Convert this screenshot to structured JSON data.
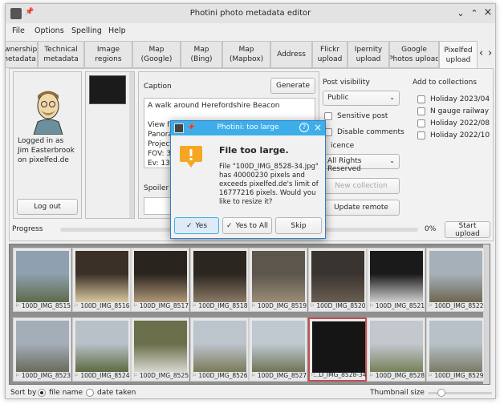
{
  "window": {
    "title": "Photini photo metadata editor",
    "controls": {
      "minimize": "⌄",
      "maximize": "⌃",
      "close": "×"
    }
  },
  "menu": [
    "File",
    "Options",
    "Spelling",
    "Help"
  ],
  "tabs": [
    {
      "label": "ownership\nmetadata"
    },
    {
      "label": "Technical\nmetadata"
    },
    {
      "label": "Image\nregions"
    },
    {
      "label": "Map\n(Google)"
    },
    {
      "label": "Map\n(Bing)"
    },
    {
      "label": "Map\n(Mapbox)"
    },
    {
      "label": "Address"
    },
    {
      "label": "Flickr\nupload"
    },
    {
      "label": "Ipernity\nupload"
    },
    {
      "label": "Google\nPhotos upload"
    },
    {
      "label": "Pixelfed\nupload"
    }
  ],
  "tab_nav": {
    "prev": "‹",
    "next": "›"
  },
  "account": {
    "logged_in_text": "Logged in as\nJim Easterbrook\non pixelfed.de",
    "logout_label": "Log out"
  },
  "caption": {
    "label": "Caption",
    "generate_label": "Generate",
    "text": "A walk around Herefordshire Beacon\n\nView from the top of the beacon hill.\nPanoram\nProjectio\nFOV: 36\nEv: 13.2"
  },
  "spoiler": {
    "label": "Spoiler"
  },
  "post_visibility": {
    "label": "Post visibility",
    "value": "Public",
    "sensitive_label": "Sensitive post",
    "disable_comments_label": "Disable comments",
    "licence_label": "icence",
    "licence_value": "All Rights Reserved",
    "new_collection_label": "New collection",
    "update_remote_label": "Update remote"
  },
  "collections": {
    "label": "Add to collections",
    "items": [
      "Holiday 2023/04",
      "N gauge railway",
      "Holiday 2022/08",
      "Holiday 2022/10"
    ]
  },
  "progress": {
    "label": "Progress",
    "percent_text": "0%",
    "value": 0,
    "start_upload_label": "Start upload"
  },
  "thumbnails": [
    "100D_IMG_8515",
    "100D_IMG_8516",
    "100D_IMG_8517",
    "100D_IMG_8518",
    "100D_IMG_8519",
    "100D_IMG_8520",
    "100D_IMG_8521",
    "100D_IMG_8522",
    "100D_IMG_8523",
    "100D_IMG_8524",
    "100D_IMG_8525",
    "100D_IMG_8526",
    "100D_IMG_8527",
    "...D_IMG_8528-34",
    "100D_IMG_8528",
    "100D_IMG_8529"
  ],
  "statusbar": {
    "sort_by_label": "Sort by",
    "file_name_label": "file name",
    "date_taken_label": "date taken",
    "thumbnail_size_label": "Thumbnail size"
  },
  "dialog": {
    "title": "Photini: too large",
    "heading": "File too large.",
    "message": "File \"100D_IMG_8528-34.jpg\" has 40000230 pixels and exceeds pixelfed.de's limit of 16777216 pixels. Would you like to resize it?",
    "yes_label": "Yes",
    "yes_to_all_label": "Yes to All",
    "skip_label": "Skip",
    "check_glyph": "✓",
    "help_glyph": "?",
    "close_glyph": "×"
  },
  "colors": {
    "accent": "#3daee9",
    "warning": "#f5a623",
    "selected_border": "#c05050"
  }
}
